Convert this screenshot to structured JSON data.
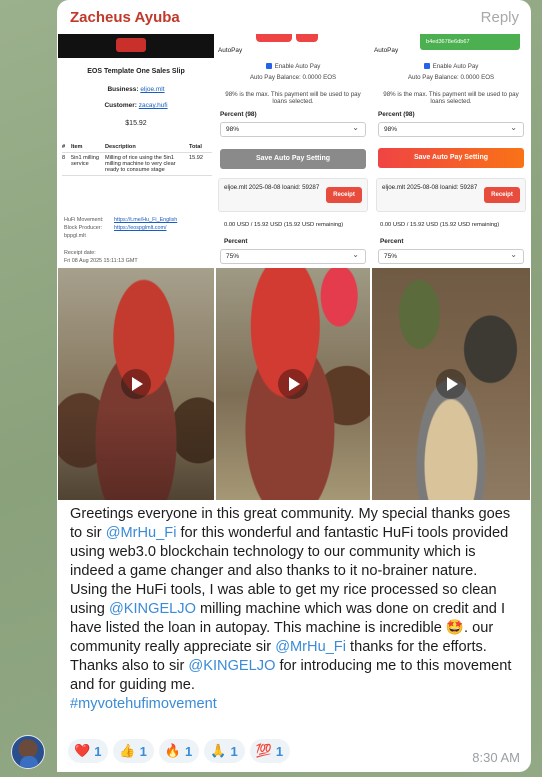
{
  "message": {
    "sender": "Zacheus Ayuba",
    "reply_label": "Reply",
    "time": "8:30 AM",
    "p1_a": "Greetings everyone in this great community. My special thanks goes to sir ",
    "p1_mention": "@MrHu_Fi",
    "p1_b": " for this wonderful and fantastic HuFi tools provided  using web3.0 blockchain technology  to our community which is indeed a game changer and also thanks to it no-brainer nature.",
    "p2_a": "  Using the HuFi tools, I was able to get my rice processed so clean using ",
    "p2_mention": "@KINGELJO",
    "p2_b": " milling machine which was done on credit and I have listed the loan in autopay. This machine is incredible 🤩. our community really appreciate  sir ",
    "p2_mention2": "@MrHu_Fi",
    "p2_c": " thanks for the efforts.",
    "p3_a": "  Thanks also to sir ",
    "p3_mention": "@KINGELJO",
    "p3_b": " for introducing me to this movement and for guiding me.",
    "hashtag": "#myvotehufimovement"
  },
  "reactions": [
    {
      "emoji": "❤️",
      "count": "1",
      "icon": "heart-icon"
    },
    {
      "emoji": "👍",
      "count": "1",
      "icon": "thumbs-up-icon"
    },
    {
      "emoji": "🔥",
      "count": "1",
      "icon": "fire-icon"
    },
    {
      "emoji": "🙏",
      "count": "1",
      "icon": "pray-icon"
    },
    {
      "emoji": "💯",
      "count": "1",
      "icon": "hundred-icon"
    }
  ],
  "receipt": {
    "title": "EOS Template One Sales Slip",
    "business_label": "Business:",
    "business_value": "eljoe.mlt",
    "customer_label": "Customer:",
    "customer_value": "zacay.hufi",
    "total": "$15.92",
    "col_num": "#",
    "col_item": "Item",
    "col_desc": "Description",
    "col_total": "Total",
    "row_num": "8",
    "row_item": "5in1 milling service",
    "row_desc": "Milling of rice using the 5in1 milling machine to very clear ready to consume stage",
    "row_total": "15.92",
    "movement_label": "HuFi Movement:",
    "movement_link": "https://t.me/Hu_Fi_English",
    "producer_label": "Block Producer:",
    "producer_value": "bppgl.mlt",
    "producer_link": "https://eospglmlt.com/",
    "date_label": "Receipt date:",
    "date_value": "Fri 08 Aug 2025 15:11:13 GMT"
  },
  "autopay_a": {
    "heading": "AutoPay",
    "enable": "Enable Auto Pay",
    "balance": "Auto Pay Balance: 0.0000 EOS",
    "note": "98% is the max. This payment will be used to pay loans selected.",
    "percent_label": "Percent (98)",
    "percent_value": "98%",
    "save": "Save Auto Pay Setting",
    "card_text": "eljoe.mlt 2025-08-08 loanid: 59287",
    "receipt_btn": "Receipt",
    "remaining": "0.00 USD / 15.92 USD (15.92 USD remaining)",
    "percent2_label": "Percent",
    "percent2_value": "75%"
  },
  "autopay_b": {
    "heading": "AutoPay",
    "pill_text": "b4ed3678e6db67",
    "enable": "Enable Auto Pay",
    "balance": "Auto Pay Balance: 0.0000 EOS",
    "note": "98% is the max. This payment will be used to pay loans selected.",
    "percent_label": "Percent (98)",
    "percent_value": "98%",
    "save": "Save Auto Pay Setting",
    "card_text": "eljoe.mlt 2025-08-08 loanid: 59287",
    "receipt_btn": "Receipt",
    "remaining": "0.00 USD / 15.92 USD (15.92 USD remaining)",
    "percent2_label": "Percent",
    "percent2_value": "75%"
  },
  "videos": [
    {
      "name": "video-milling-machine-1"
    },
    {
      "name": "video-milling-machine-2"
    },
    {
      "name": "video-rice-bowl"
    }
  ],
  "colors": {
    "sender": "#c0392b",
    "link": "#3a8bd8",
    "save_disabled": "#8a8a8a",
    "save_active": "#ef4444"
  }
}
